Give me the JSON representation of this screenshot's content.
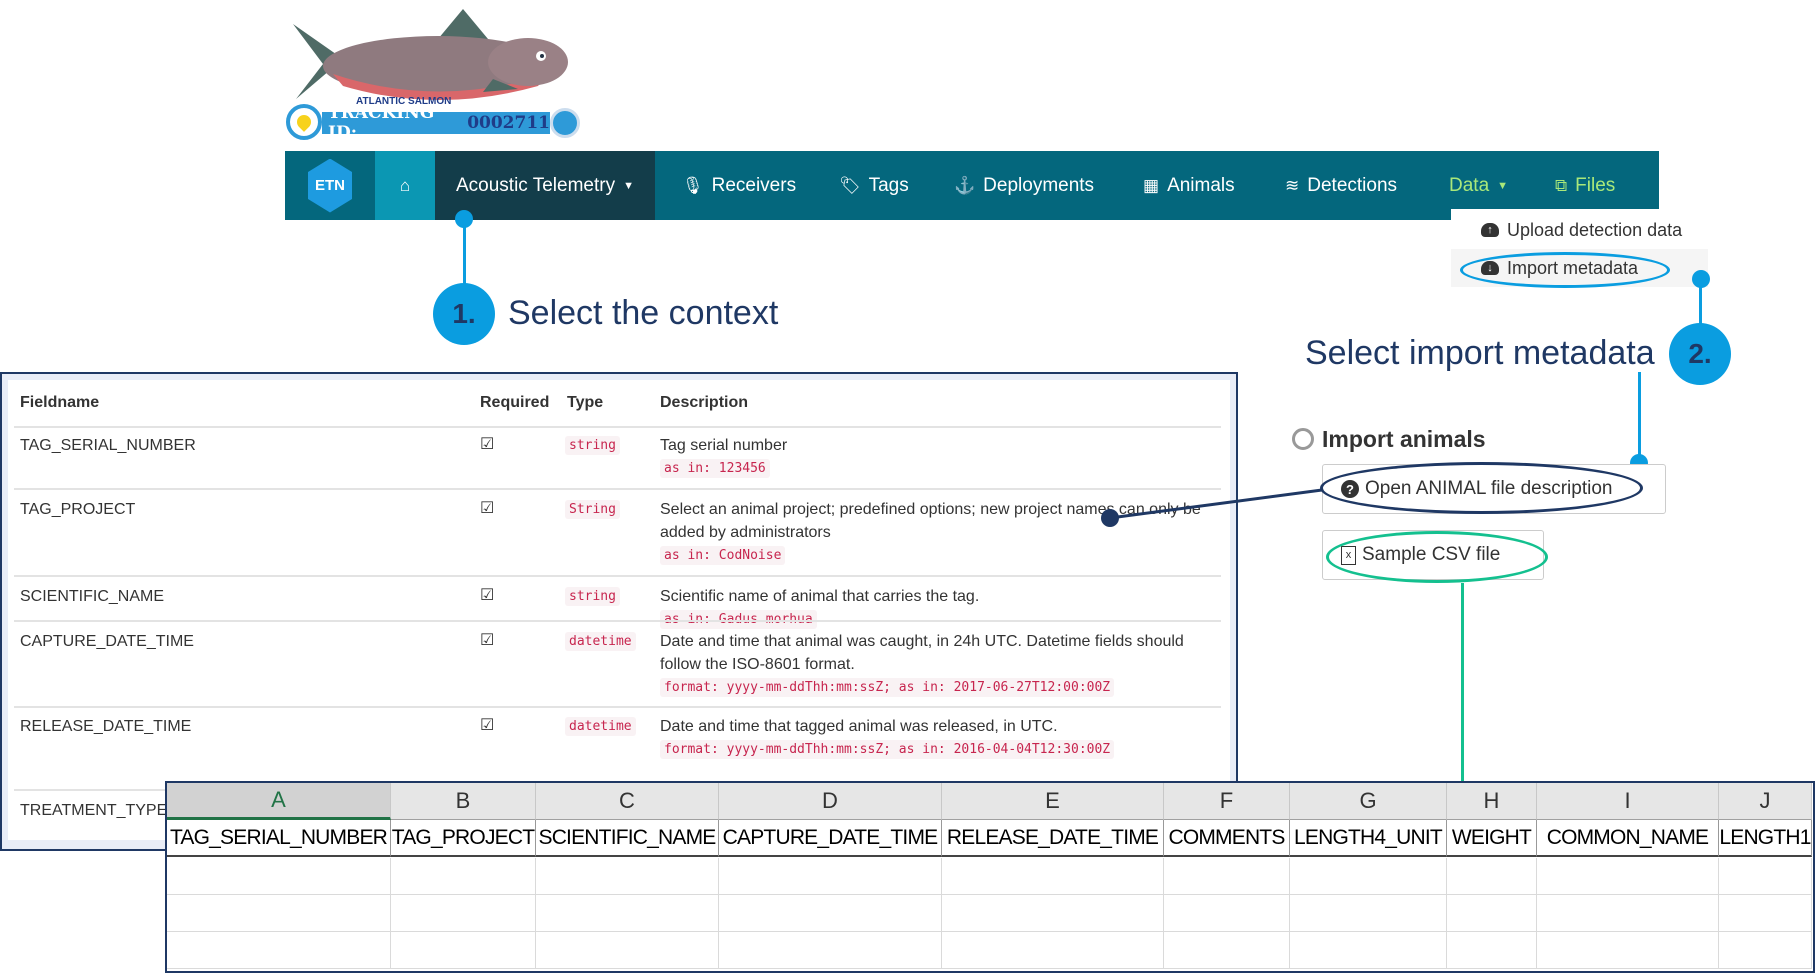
{
  "logo": {
    "species": "ATLANTIC SALMON",
    "tracking_label": "TRACKING ID:",
    "tracking_id": "0002711"
  },
  "nav": {
    "brand": "ETN",
    "items": [
      {
        "label": "Acoustic Telemetry",
        "icon": "caret-down-icon"
      },
      {
        "label": "Receivers",
        "icon": "microphone-icon"
      },
      {
        "label": "Tags",
        "icon": "tags-icon"
      },
      {
        "label": "Deployments",
        "icon": "anchor-icon"
      },
      {
        "label": "Animals",
        "icon": "table-icon"
      },
      {
        "label": "Detections",
        "icon": "database-icon"
      },
      {
        "label": "Data",
        "icon": "caret-down-icon"
      },
      {
        "label": "Files",
        "icon": "files-icon"
      }
    ],
    "colors": {
      "bar": "#04677d",
      "active": "#133d4a",
      "home": "#0b97b3",
      "data": "#a9e87a"
    }
  },
  "dropdown": {
    "items": [
      {
        "label": "Upload detection data"
      },
      {
        "label": "Import metadata"
      }
    ]
  },
  "callouts": [
    {
      "number": "1.",
      "text": "Select the context"
    },
    {
      "number": "2.",
      "text": "Select import metadata"
    }
  ],
  "import": {
    "title": "Import animals",
    "open_description": "Open ANIMAL file description",
    "sample_csv": "Sample CSV file"
  },
  "field_table": {
    "headers": [
      "Fieldname",
      "Required",
      "Type",
      "Description"
    ],
    "rows": [
      {
        "field": "TAG_SERIAL_NUMBER",
        "type": "string",
        "desc": "Tag serial number",
        "example": "as in: 123456"
      },
      {
        "field": "TAG_PROJECT",
        "type": "String",
        "desc": "Select an animal project; predefined options; new project names can only be added by administrators",
        "example": "as in: CodNoise"
      },
      {
        "field": "SCIENTIFIC_NAME",
        "type": "string",
        "desc": "Scientific name of animal that carries the tag.",
        "example": "as in: Gadus morhua"
      },
      {
        "field": "CAPTURE_DATE_TIME",
        "type": "datetime",
        "desc": "Date and time that animal was caught, in 24h UTC. Datetime fields should follow the ISO-8601 format.",
        "example": "format: yyyy-mm-ddThh:mm:ssZ; as in: 2017-06-27T12:00:00Z"
      },
      {
        "field": "RELEASE_DATE_TIME",
        "type": "datetime",
        "desc": "Date and time that tagged animal was released, in UTC.",
        "example": "format: yyyy-mm-ddThh:mm:ssZ; as in: 2016-04-04T12:30:00Z"
      },
      {
        "field": "TREATMENT_TYPE"
      }
    ]
  },
  "spreadsheet": {
    "columns": [
      "A",
      "B",
      "C",
      "D",
      "E",
      "F",
      "G",
      "H",
      "I",
      "J"
    ],
    "headers": [
      "TAG_SERIAL_NUMBER",
      "TAG_PROJECT",
      "SCIENTIFIC_NAME",
      "CAPTURE_DATE_TIME",
      "RELEASE_DATE_TIME",
      "COMMENTS",
      "LENGTH4_UNIT",
      "WEIGHT",
      "COMMON_NAME",
      "LENGTH1"
    ],
    "selected_column": "A"
  }
}
